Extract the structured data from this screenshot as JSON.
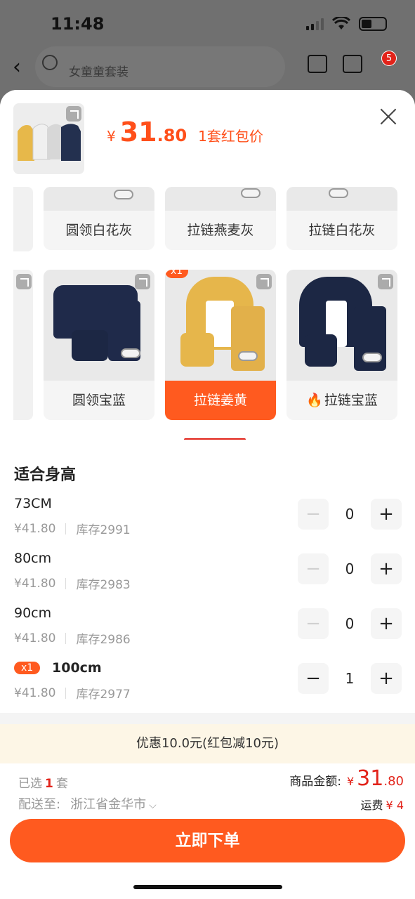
{
  "status": {
    "time": "11:48"
  },
  "background": {
    "search_text": "女童童套装"
  },
  "cart_badge": "5",
  "sheet": {
    "price_currency": "¥",
    "price_int": "31",
    "price_dec": ".80",
    "price_tag": "1套红包价",
    "variants_top": [
      "圆领白花灰",
      "拉链燕麦灰",
      "拉链白花灰"
    ],
    "variants": [
      {
        "label": "圆领宝蓝",
        "selected": false,
        "badge": "",
        "hot": false
      },
      {
        "label": "拉链姜黄",
        "selected": true,
        "badge": "x1",
        "hot": false
      },
      {
        "label": "拉链宝蓝",
        "selected": false,
        "badge": "",
        "hot": true
      }
    ],
    "sizes_title": "适合身高",
    "sizes": [
      {
        "name": "73CM",
        "price": "¥41.80",
        "stock": "库存2991",
        "qty": "0",
        "badge": ""
      },
      {
        "name": "80cm",
        "price": "¥41.80",
        "stock": "库存2983",
        "qty": "0",
        "badge": ""
      },
      {
        "name": "90cm",
        "price": "¥41.80",
        "stock": "库存2986",
        "qty": "0",
        "badge": ""
      },
      {
        "name": "100cm",
        "price": "¥41.80",
        "stock": "库存2977",
        "qty": "1",
        "badge": "x1"
      }
    ],
    "promo": "优惠10.0元(红包减10元)",
    "footer": {
      "selected_prefix": "已选",
      "selected_count": "1",
      "selected_suffix": "套",
      "ship_label": "配送至:",
      "ship_addr": "浙江省金华市",
      "total_label": "商品金额:",
      "total_cur": "¥",
      "total_int": "31",
      "total_dec": ".80",
      "freight_label": "运费",
      "freight_value": "¥ 4",
      "order_button": "立即下单"
    }
  },
  "colors": {
    "accent": "#ff5a1f",
    "price": "#ff4f1a",
    "red": "#e2231a"
  }
}
